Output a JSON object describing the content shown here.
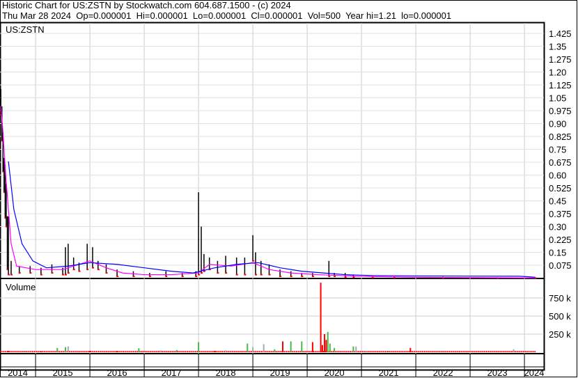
{
  "header": {
    "title": "Historic Chart for US:ZSTN by Stockwatch.com 604.687.1500 - (c) 2024",
    "quote": "Thu Mar 28 2024  Op=0.000001  Hi=0.000001  Lo=0.000001  Cl=0.000001  Vol=500  Year hi=1.21  lo=0.000001"
  },
  "chart_data": [
    {
      "type": "line",
      "title": "US:ZSTN",
      "ylim": [
        0,
        1.475
      ],
      "yticks": [
        "1.425",
        "1.35",
        "1.275",
        "1.20",
        "1.125",
        "1.05",
        "0.975",
        "0.90",
        "0.825",
        "0.75",
        "0.675",
        "0.60",
        "0.525",
        "0.45",
        "0.375",
        "0.30",
        "0.225",
        "0.15",
        "0.075"
      ],
      "xticks": [
        "2014",
        "2015",
        "2016",
        "2017",
        "2018",
        "2019",
        "2020",
        "2021",
        "2022",
        "2023",
        "2024"
      ],
      "colors": {
        "bar": "#000000",
        "down": "#ff0000",
        "ma_short": "#ff00ff",
        "ma_long": "#0000ff"
      },
      "hilo": [
        [
          2014.36,
          1.1,
          0.95
        ],
        [
          2014.38,
          1.0,
          0.8
        ],
        [
          2014.4,
          0.85,
          0.62
        ],
        [
          2014.42,
          0.7,
          0.5
        ],
        [
          2014.44,
          0.66,
          0.35
        ],
        [
          2014.46,
          0.55,
          0.3
        ],
        [
          2014.48,
          0.36,
          0.05
        ],
        [
          2014.5,
          0.36,
          0.02
        ],
        [
          2014.55,
          0.1,
          0.02
        ],
        [
          2014.7,
          0.07,
          0.03
        ],
        [
          2014.9,
          0.07,
          0.03
        ],
        [
          2015.1,
          0.06,
          0.02
        ],
        [
          2015.3,
          0.08,
          0.03
        ],
        [
          2015.5,
          0.06,
          0.02
        ],
        [
          2015.55,
          0.18,
          0.02
        ],
        [
          2015.6,
          0.2,
          0.03
        ],
        [
          2015.7,
          0.12,
          0.05
        ],
        [
          2015.8,
          0.09,
          0.04
        ],
        [
          2015.95,
          0.2,
          0.05
        ],
        [
          2016.05,
          0.18,
          0.06
        ],
        [
          2016.15,
          0.1,
          0.05
        ],
        [
          2016.3,
          0.08,
          0.03
        ],
        [
          2016.5,
          0.05,
          0.01
        ],
        [
          2016.8,
          0.04,
          0.01
        ],
        [
          2017.1,
          0.03,
          0.01
        ],
        [
          2017.4,
          0.04,
          0.01
        ],
        [
          2017.7,
          0.03,
          0.01
        ],
        [
          2017.95,
          0.04,
          0.01
        ],
        [
          2018.0,
          0.5,
          0.02
        ],
        [
          2018.05,
          0.3,
          0.03
        ],
        [
          2018.1,
          0.14,
          0.04
        ],
        [
          2018.2,
          0.12,
          0.05
        ],
        [
          2018.35,
          0.1,
          0.03
        ],
        [
          2018.5,
          0.13,
          0.03
        ],
        [
          2018.7,
          0.12,
          0.02
        ],
        [
          2018.85,
          0.12,
          0.02
        ],
        [
          2019.0,
          0.25,
          0.1
        ],
        [
          2019.05,
          0.15,
          0.02
        ],
        [
          2019.15,
          0.1,
          0.02
        ],
        [
          2019.3,
          0.08,
          0.02
        ],
        [
          2019.5,
          0.05,
          0.01
        ],
        [
          2019.7,
          0.04,
          0.01
        ],
        [
          2019.9,
          0.03,
          0.01
        ],
        [
          2020.1,
          0.03,
          0.01
        ],
        [
          2020.4,
          0.1,
          0.01
        ],
        [
          2020.5,
          0.03,
          0.01
        ],
        [
          2020.7,
          0.03,
          0.005
        ],
        [
          2020.85,
          0.02,
          0.005
        ],
        [
          2021.2,
          0.01,
          0.002
        ],
        [
          2021.6,
          0.01,
          0.002
        ],
        [
          2022.5,
          0.008,
          0.001
        ],
        [
          2023.5,
          0.005,
          0.0001
        ],
        [
          2024.2,
          0.001,
          1e-06
        ]
      ],
      "ma_short": [
        [
          2014.36,
          1.0
        ],
        [
          2014.4,
          0.85
        ],
        [
          2014.45,
          0.6
        ],
        [
          2014.5,
          0.4
        ],
        [
          2014.55,
          0.2
        ],
        [
          2014.65,
          0.07
        ],
        [
          2015.0,
          0.05
        ],
        [
          2015.5,
          0.05
        ],
        [
          2015.7,
          0.07
        ],
        [
          2016.0,
          0.1
        ],
        [
          2016.3,
          0.06
        ],
        [
          2016.6,
          0.03
        ],
        [
          2017.0,
          0.02
        ],
        [
          2017.5,
          0.02
        ],
        [
          2018.0,
          0.03
        ],
        [
          2018.2,
          0.08
        ],
        [
          2018.6,
          0.07
        ],
        [
          2019.0,
          0.09
        ],
        [
          2019.3,
          0.05
        ],
        [
          2019.7,
          0.03
        ],
        [
          2020.2,
          0.02
        ],
        [
          2020.6,
          0.015
        ],
        [
          2021.0,
          0.01
        ],
        [
          2022.0,
          0.005
        ],
        [
          2023.0,
          0.003
        ],
        [
          2024.2,
          0.001
        ]
      ],
      "ma_long": [
        [
          2014.5,
          0.68
        ],
        [
          2014.6,
          0.4
        ],
        [
          2014.75,
          0.2
        ],
        [
          2014.95,
          0.1
        ],
        [
          2015.2,
          0.06
        ],
        [
          2015.6,
          0.07
        ],
        [
          2016.0,
          0.09
        ],
        [
          2016.5,
          0.08
        ],
        [
          2017.0,
          0.06
        ],
        [
          2017.5,
          0.04
        ],
        [
          2017.9,
          0.03
        ],
        [
          2018.3,
          0.06
        ],
        [
          2018.7,
          0.08
        ],
        [
          2019.1,
          0.09
        ],
        [
          2019.5,
          0.06
        ],
        [
          2019.9,
          0.04
        ],
        [
          2020.3,
          0.03
        ],
        [
          2020.7,
          0.02
        ],
        [
          2021.2,
          0.015
        ],
        [
          2022.0,
          0.013
        ],
        [
          2023.0,
          0.012
        ],
        [
          2023.9,
          0.011
        ],
        [
          2024.2,
          0.005
        ]
      ]
    },
    {
      "type": "bar",
      "title": "Volume",
      "ylim": [
        0,
        1050000
      ],
      "yticks": [
        "750 k",
        "500 k",
        "250 k"
      ],
      "bars": [
        [
          2014.5,
          20000,
          "r"
        ],
        [
          2014.8,
          15000,
          "g"
        ],
        [
          2015.1,
          10000,
          "r"
        ],
        [
          2015.4,
          60000,
          "g"
        ],
        [
          2015.55,
          70000,
          "g"
        ],
        [
          2015.6,
          80000,
          "x"
        ],
        [
          2016.0,
          20000,
          "r"
        ],
        [
          2016.5,
          15000,
          "r"
        ],
        [
          2016.9,
          55000,
          "g"
        ],
        [
          2017.3,
          25000,
          "x"
        ],
        [
          2017.6,
          30000,
          "g"
        ],
        [
          2018.0,
          140000,
          "g"
        ],
        [
          2018.3,
          20000,
          "r"
        ],
        [
          2018.5,
          25000,
          "x"
        ],
        [
          2018.9,
          120000,
          "g"
        ],
        [
          2019.0,
          70000,
          "x"
        ],
        [
          2019.2,
          110000,
          "x"
        ],
        [
          2019.4,
          40000,
          "g"
        ],
        [
          2019.55,
          150000,
          "r"
        ],
        [
          2019.7,
          150000,
          "g"
        ],
        [
          2019.9,
          150000,
          "g"
        ],
        [
          2020.1,
          140000,
          "r"
        ],
        [
          2020.25,
          960000,
          "r"
        ],
        [
          2020.28,
          100000,
          "r"
        ],
        [
          2020.32,
          250000,
          "r"
        ],
        [
          2020.35,
          170000,
          "r"
        ],
        [
          2020.38,
          280000,
          "g"
        ],
        [
          2020.42,
          120000,
          "g"
        ],
        [
          2020.5,
          60000,
          "g"
        ],
        [
          2020.85,
          80000,
          "g"
        ],
        [
          2020.9,
          80000,
          "x"
        ],
        [
          2021.1,
          20000,
          "x"
        ],
        [
          2021.5,
          20000,
          "g"
        ],
        [
          2021.9,
          60000,
          "r"
        ],
        [
          2022.5,
          10000,
          "g"
        ],
        [
          2023.0,
          10000,
          "x"
        ],
        [
          2023.8,
          40000,
          "x"
        ],
        [
          2024.1,
          10000,
          "x"
        ]
      ]
    }
  ]
}
